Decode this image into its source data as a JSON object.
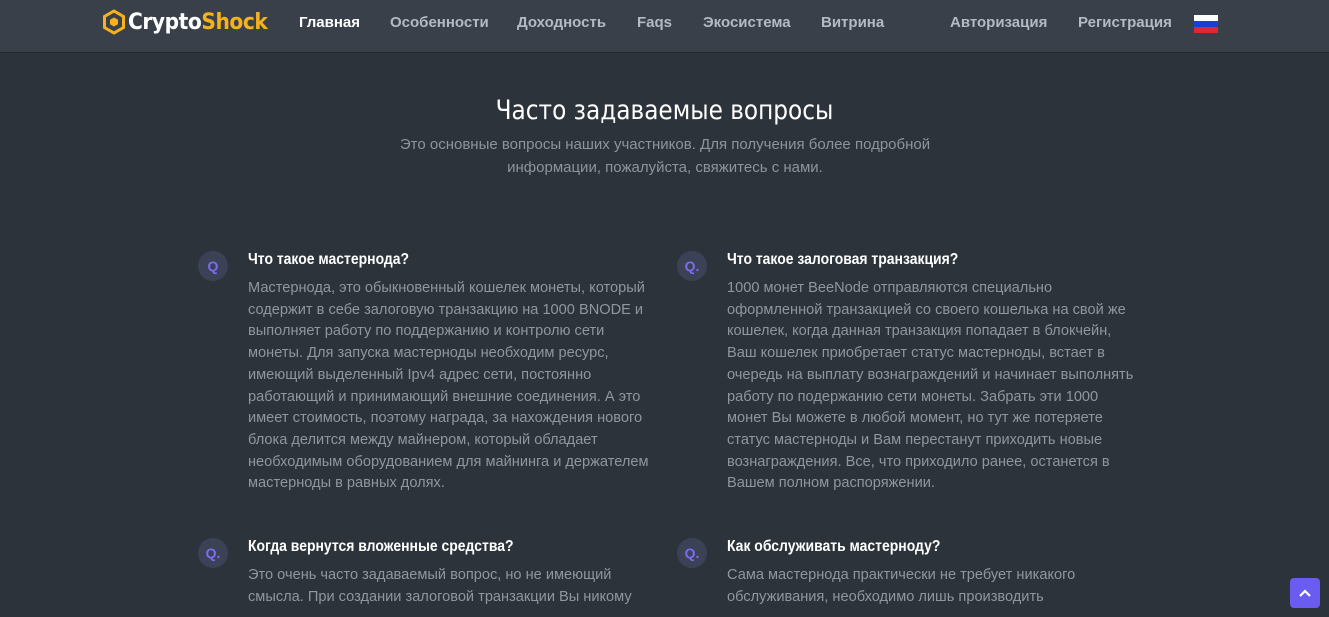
{
  "brand": {
    "part1": "Crypto",
    "part2": "Shock",
    "colors": {
      "white": "#ffffff",
      "accent": "#f7b21b"
    }
  },
  "nav": {
    "items": [
      "Главная",
      "Особенности",
      "Доходность",
      "Faqs",
      "Экосистема",
      "Витрина"
    ],
    "auth": [
      "Авторизация",
      "Регистрация"
    ],
    "language_icon": "russia-flag-icon"
  },
  "faq_section": {
    "title": "Часто задаваемые вопросы",
    "subtitle": "Это основные вопросы наших участников. Для получения более подробной информации, пожалуйста, свяжитесь с нами."
  },
  "faqs": [
    {
      "badge": "Q",
      "question": "Что такое мастернода?",
      "answer": "Мастернода, это обыкновенный кошелек монеты, который содержит в себе залоговую транзакцию на 1000 BNODE и выполняет работу по поддержанию и контролю сети монеты. Для запуска мастерноды необходим ресурс, имеющий выделенный Ipv4 адрес сети, постоянно работающий и принимающий внешние соединения. А это имеет стоимость, поэтому награда, за нахождения нового блока делится между майнером, который обладает необходимым оборудованием для майнинга и держателем мастерноды в равных долях."
    },
    {
      "badge": "Q.",
      "question": "Что такое залоговая транзакция?",
      "answer": "1000 монет BeeNode отправляются специально оформленной транзакцией со своего кошелька на свой же кошелек, когда данная транзакция попадает в блокчейн, Ваш кошелек приобретает статус мастерноды, встает в очередь на выплату вознаграждений и начинает выполнять работу по подержанию сети монеты. Забрать эти 1000 монет Вы можете в любой момент, но тут же потеряете статус мастерноды и Вам перестанут приходить новые вознаграждения. Все, что приходило ранее, останется в Вашем полном распоряжении."
    },
    {
      "badge": "Q.",
      "question": "Когда вернутся вложенные средства?",
      "answer": "Это очень часто задаваемый вопрос, но не имеющий смысла. При создании залоговой транзакции Вы никому"
    },
    {
      "badge": "Q.",
      "question": "Как обслуживать мастерноду?",
      "answer": "Сама мастернода практически не требует никакого обслуживания, необходимо лишь производить"
    }
  ],
  "scroll_top_icon": "chevron-up-icon"
}
